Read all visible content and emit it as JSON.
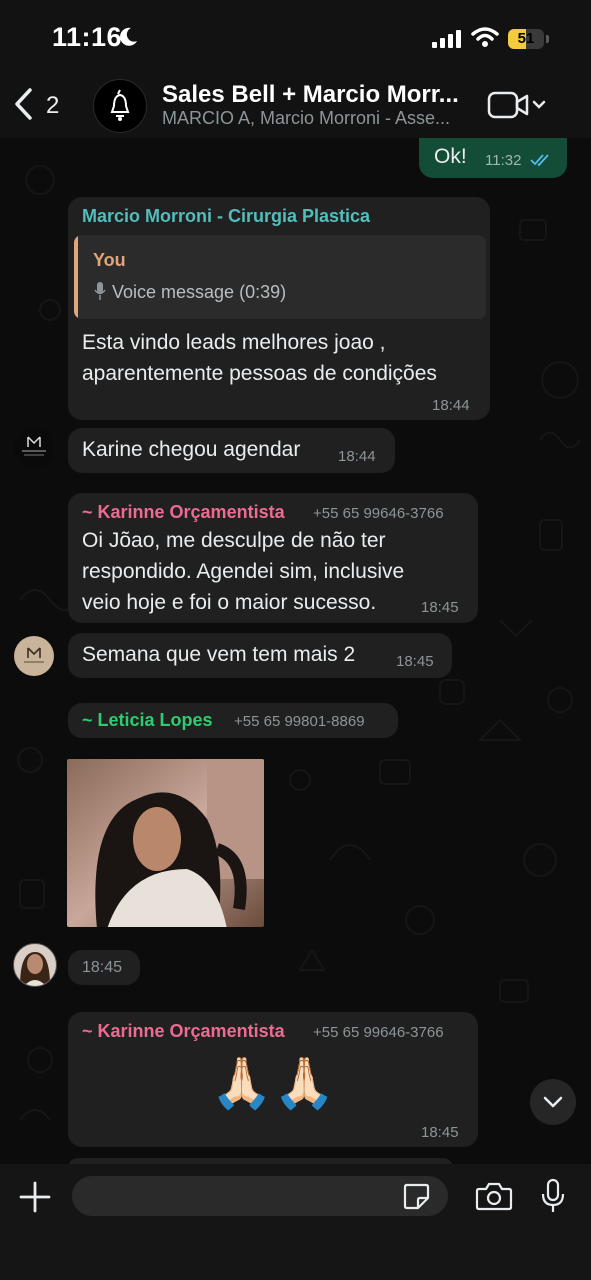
{
  "status_bar": {
    "time": "11:16",
    "battery": "51",
    "battery_level": 0.51
  },
  "header": {
    "back_count": "2",
    "title": "Sales Bell + Marcio Morr...",
    "subtitle": "MARCIO A, Marcio Morroni - Asse...",
    "icons": [
      "back-chevron-icon",
      "group-avatar",
      "video-call-icon",
      "chevron-down-icon"
    ]
  },
  "messages": [
    {
      "type": "outgoing",
      "text": "Ok!",
      "time": "11:32",
      "status": "read"
    },
    {
      "type": "incoming",
      "sender": "Marcio Morroni - Cirurgia Plastica",
      "reply": {
        "author": "You",
        "label": "Voice message (0:39)"
      },
      "lines": [
        "Esta vindo leads melhores joao ,",
        "aparentemente pessoas de condições"
      ],
      "time": "18:44"
    },
    {
      "type": "incoming",
      "text": "Karine chegou agendar",
      "time": "18:44"
    },
    {
      "type": "incoming",
      "sender": "~ Karinne Orçamentista",
      "phone": "+55 65 99646-3766",
      "lines": [
        "Oi Jõao, me desculpe de não ter",
        "respondido. Agendei sim, inclusive",
        "veio hoje e foi o maior sucesso."
      ],
      "time": "18:45"
    },
    {
      "type": "incoming",
      "text": "Semana que vem tem mais 2",
      "time": "18:45"
    },
    {
      "type": "incoming",
      "sender": "~ Leticia Lopes",
      "phone": "+55 65 99801-8869",
      "media": "sticker-image",
      "time": "18:45"
    },
    {
      "type": "incoming",
      "sender": "~ Karinne Orçamentista",
      "phone": "+55 65 99646-3766",
      "text": "🙏🏻🙏🏻",
      "time": "18:45"
    }
  ],
  "composer": {
    "placeholder": "",
    "icons": [
      "plus-icon",
      "sticker-icon",
      "camera-icon",
      "microphone-icon"
    ]
  },
  "colors": {
    "outgoing_bubble": "#134d37",
    "incoming_bubble": "#202020",
    "sender_teal": "#53bdbb",
    "sender_pink": "#ec6b93",
    "sender_green": "#2ecc71",
    "reply_author": "#e0a57a",
    "read_ticks": "#53bdeb"
  }
}
